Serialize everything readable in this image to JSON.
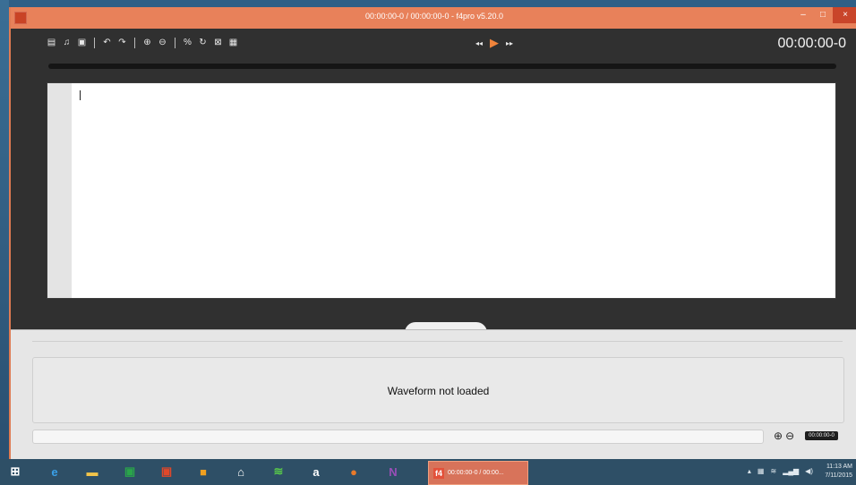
{
  "window": {
    "title": "00:00:00-0 / 00:00:00-0 -  f4pro v5.20.0",
    "controls": {
      "minimize": "–",
      "maximize": "□",
      "close": "×"
    }
  },
  "toolbar": {
    "icons": [
      "new-document-icon",
      "music-note-icon",
      "save-icon",
      "undo-icon",
      "redo-icon",
      "zoom-in-icon",
      "zoom-out-icon",
      "timestamp-icon",
      "refresh-icon",
      "fullscreen-icon",
      "video-icon"
    ],
    "glyphs": {
      "new": "▤",
      "music": "♫",
      "save": "▣",
      "undo": "↶",
      "redo": "↷",
      "zoom_in": "⊕",
      "zoom_out": "⊖",
      "timestamp": "%",
      "refresh": "↻",
      "fullscreen": "⊠",
      "video": "▦"
    }
  },
  "transport": {
    "rewind": "◂◂",
    "play": "▶",
    "forward": "▸▸"
  },
  "timecode": "00:00:00-0",
  "editor": {
    "text": ""
  },
  "waveform": {
    "message": "Waveform not loaded",
    "zoom_in": "⊕",
    "zoom_out": "⊖",
    "timecode": "00:00:00-0"
  },
  "taskbar": {
    "apps": [
      {
        "name": "start-icon",
        "glyph": "⊞",
        "color": "#ffffff"
      },
      {
        "name": "internet-explorer-icon",
        "glyph": "e",
        "color": "#3aa0e8"
      },
      {
        "name": "file-explorer-icon",
        "glyph": "▬",
        "color": "#f2c44a"
      },
      {
        "name": "store-icon",
        "glyph": "▣",
        "color": "#2aa54a"
      },
      {
        "name": "photos-icon",
        "glyph": "▣",
        "color": "#e0482a"
      },
      {
        "name": "app-orange-icon",
        "glyph": "■",
        "color": "#f0a020"
      },
      {
        "name": "home-icon",
        "glyph": "⌂",
        "color": "#ffffff"
      },
      {
        "name": "spotify-icon",
        "glyph": "≋",
        "color": "#58c94a"
      },
      {
        "name": "amazon-icon",
        "glyph": "a",
        "color": "#ffffff"
      },
      {
        "name": "firefox-icon",
        "glyph": "●",
        "color": "#e87a2a"
      },
      {
        "name": "onenote-icon",
        "glyph": "N",
        "color": "#9a4fb8"
      }
    ],
    "active_window": {
      "icon": "f4",
      "label": "00:00:00-0 / 00:00..."
    },
    "clock_time": "11:13 AM",
    "clock_date": "7/11/2015"
  }
}
